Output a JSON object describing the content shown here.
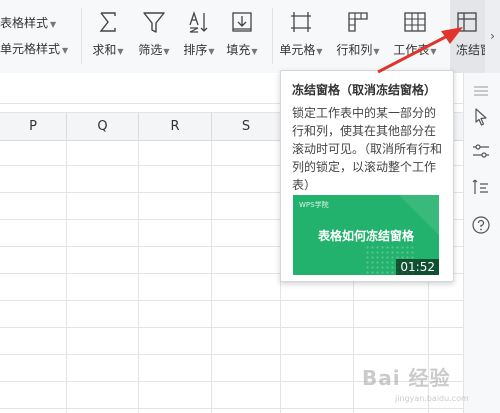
{
  "ribbon": {
    "style_buttons": [
      {
        "label": "表格样式"
      },
      {
        "label": "单元格样式"
      }
    ],
    "tools": [
      {
        "label": "求和",
        "icon": "sigma-icon"
      },
      {
        "label": "筛选",
        "icon": "filter-icon"
      },
      {
        "label": "排序",
        "icon": "sort-icon"
      },
      {
        "label": "填充",
        "icon": "fill-down-icon"
      },
      {
        "label": "单元格",
        "icon": "cell-icon"
      },
      {
        "label": "行和列",
        "icon": "rows-columns-icon"
      },
      {
        "label": "工作表",
        "icon": "worksheet-icon"
      },
      {
        "label": "冻结窗",
        "icon": "freeze-panes-icon"
      }
    ],
    "overflow_glyph": "›"
  },
  "columns": [
    "P",
    "Q",
    "R",
    "S"
  ],
  "tooltip": {
    "title": "冻结窗格（取消冻结窗格）",
    "description": "锁定工作表中的某一部分的行和列，使其在其他部分在滚动时可见。（取消所有行和列的锁定，以滚动整个工作表）",
    "video": {
      "brand": "WPS学院",
      "title": "表格如何冻结窗格",
      "duration": "01:52",
      "color": "#23b26d"
    }
  },
  "side_panel_icons": [
    "menu-lines-icon",
    "pointer-icon",
    "sliders-icon",
    "transform-icon",
    "help-icon"
  ],
  "watermark": {
    "text": "Bai 经验",
    "sub": "jingyan.baidu.com"
  },
  "colors": {
    "accent_green": "#23b26d",
    "annotation_red": "#e0342c"
  }
}
